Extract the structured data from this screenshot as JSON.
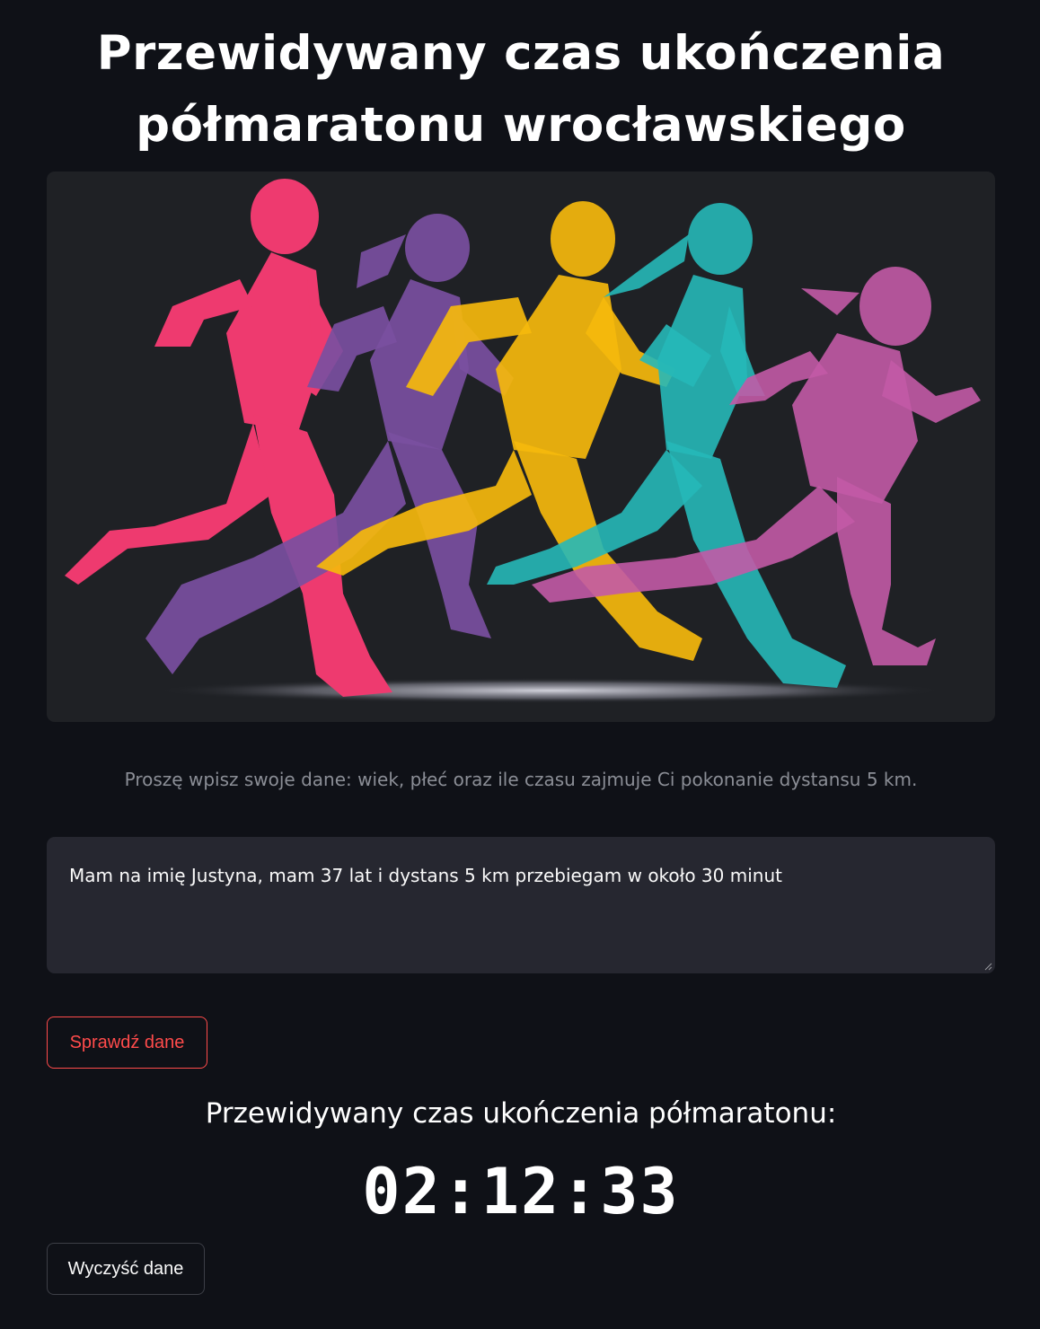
{
  "page": {
    "title_line1": "Przewidywany czas ukończenia",
    "title_line2": "półmaratonu wrocławskiego",
    "hero_image": "five-colorful-runners-silhouette",
    "instructions": "Proszę wpisz swoje dane: wiek, płeć oraz ile czasu zajmuje Ci pokonanie dystansu 5 km.",
    "input": {
      "value": "Mam na imię Justyna, mam 37 lat i dystans 5 km przebiegam w około 30 minut",
      "placeholder": ""
    },
    "check_button": "Sprawdź dane",
    "result_label": "Przewidywany czas ukończenia półmaratonu:",
    "result_time": "02:12:33",
    "clear_button": "Wyczyść dane"
  },
  "colors": {
    "background": "#0f1117",
    "image_background": "#1f2125",
    "input_background": "#262730",
    "accent": "#ff4b4b",
    "runner_pink": "#ee3a6f",
    "runner_purple": "#7a4fa0",
    "runner_yellow": "#f5b80c",
    "runner_teal": "#26b8b8",
    "runner_magenta": "#c25aa6"
  }
}
